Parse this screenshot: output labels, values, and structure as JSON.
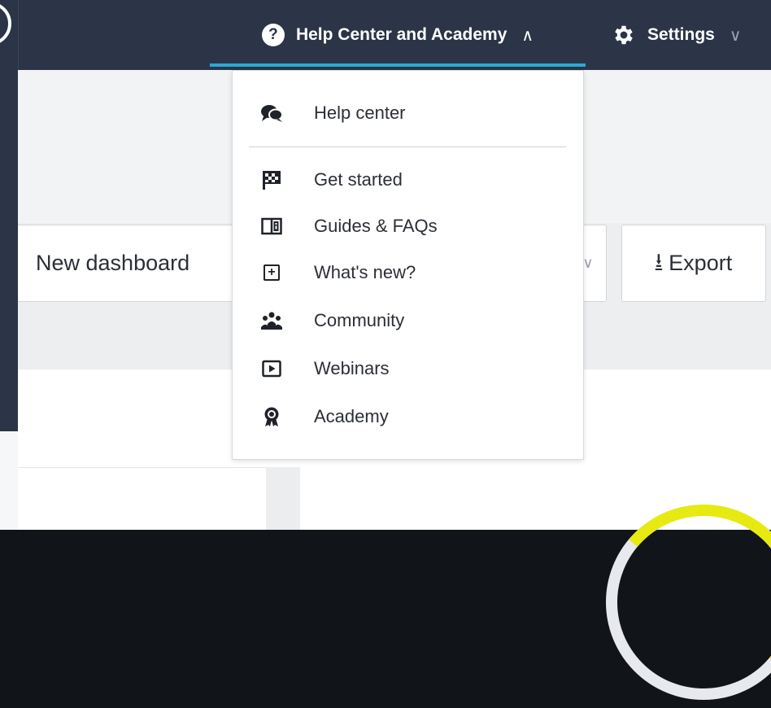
{
  "nav": {
    "help_label": "Help Center and Academy",
    "help_chevron": "∧",
    "settings_label": "Settings",
    "settings_chevron": "∨",
    "accent_color": "#29a9d6"
  },
  "toolbar": {
    "new_dashboard_label": "New dashboard",
    "export_label": "Export",
    "export_icon": "download-icon",
    "hidden_chevron": "∨"
  },
  "help_menu": {
    "items": [
      {
        "label": "Help center",
        "icon": "chat-bubbles-icon"
      },
      {
        "label": "Get started",
        "icon": "checkered-flag-icon"
      },
      {
        "label": "Guides & FAQs",
        "icon": "book-icon"
      },
      {
        "label": "What's new?",
        "icon": "plus-box-icon"
      },
      {
        "label": "Community",
        "icon": "people-group-icon"
      },
      {
        "label": "Webinars",
        "icon": "play-box-icon"
      },
      {
        "label": "Academy",
        "icon": "award-badge-icon"
      }
    ]
  },
  "colors": {
    "topbar": "#2b3547",
    "gauge": "#e6ea10"
  }
}
